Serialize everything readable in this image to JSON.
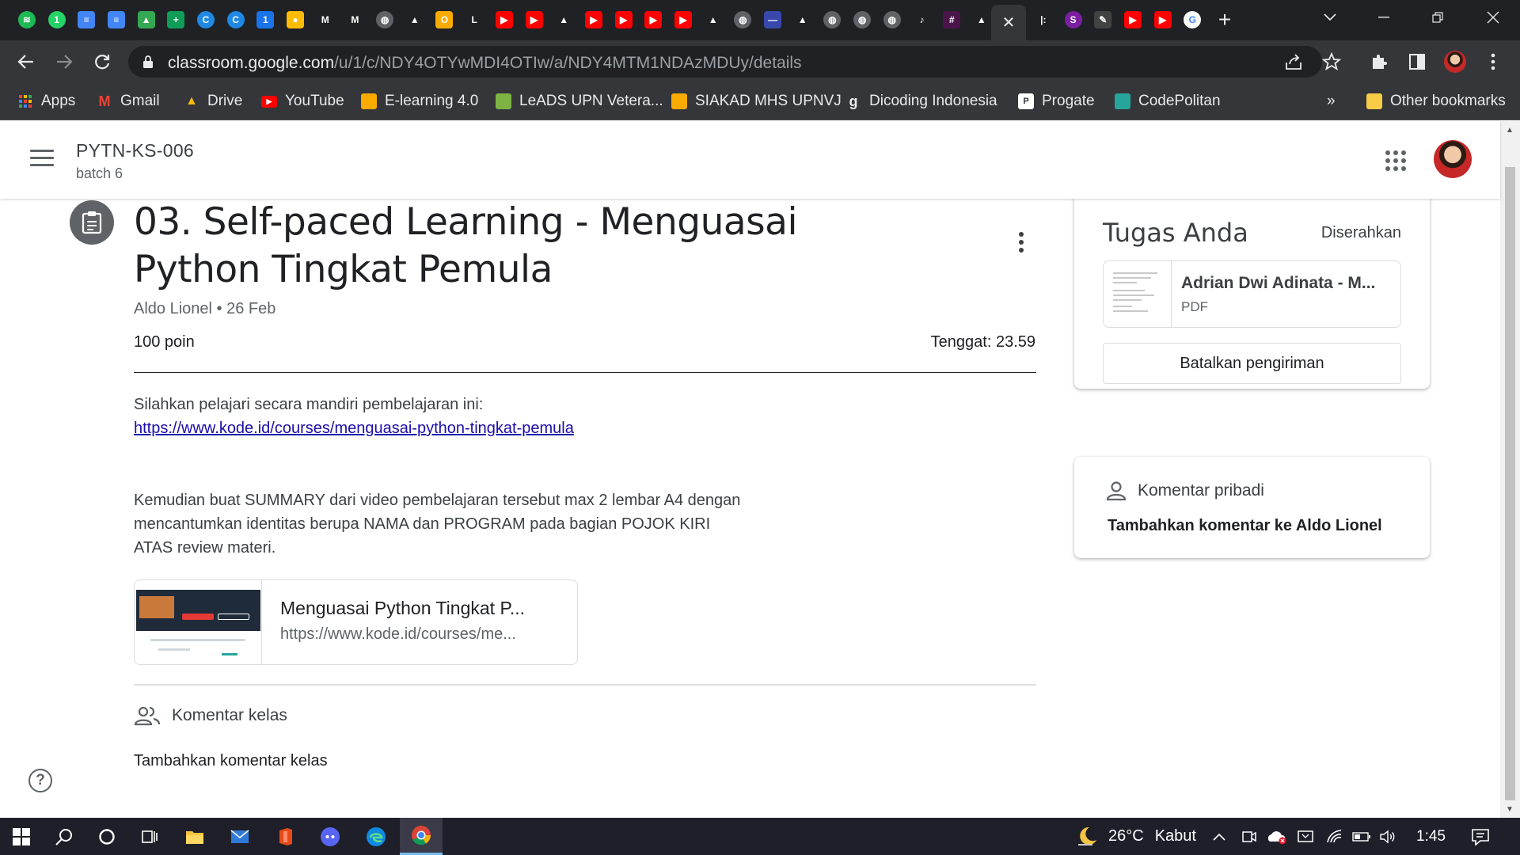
{
  "tabs": {
    "favicons": [
      {
        "name": "spotify-icon",
        "bg": "#1db954",
        "glyph": "≋",
        "round": true
      },
      {
        "name": "whatsapp-icon",
        "bg": "#25d366",
        "glyph": "1",
        "round": true
      },
      {
        "name": "google-docs-icon",
        "bg": "#4285f4",
        "glyph": "≡",
        "round": false
      },
      {
        "name": "google-docs-icon",
        "bg": "#4285f4",
        "glyph": "≡",
        "round": false
      },
      {
        "name": "google-drive-icon",
        "bg": "#34a853",
        "glyph": "▲",
        "round": false
      },
      {
        "name": "google-sheets-icon",
        "bg": "#0f9d58",
        "glyph": "+",
        "round": false
      },
      {
        "name": "codepolitan-icon",
        "bg": "#1e88e5",
        "glyph": "C",
        "round": true
      },
      {
        "name": "codepolitan-icon",
        "bg": "#1e88e5",
        "glyph": "C",
        "round": true
      },
      {
        "name": "calendar-icon",
        "bg": "#1a73e8",
        "glyph": "1",
        "round": false
      },
      {
        "name": "keep-icon",
        "bg": "#fbbc04",
        "glyph": "●",
        "round": false
      },
      {
        "name": "gmail-icon",
        "bg": "#202124",
        "glyph": "M",
        "round": false
      },
      {
        "name": "gmail-icon",
        "bg": "#202124",
        "glyph": "M",
        "round": false
      },
      {
        "name": "globe-icon",
        "bg": "#5f6368",
        "glyph": "◍",
        "round": true
      },
      {
        "name": "google-drive-icon",
        "bg": "#202124",
        "glyph": "▲",
        "round": false
      },
      {
        "name": "upnvj-icon",
        "bg": "#f9ab00",
        "glyph": "O",
        "round": false
      },
      {
        "name": "leads-upnvj-icon",
        "bg": "#202124",
        "glyph": "L",
        "round": false
      },
      {
        "name": "youtube-icon",
        "bg": "#ff0000",
        "glyph": "▶",
        "round": false
      },
      {
        "name": "youtube-icon",
        "bg": "#ff0000",
        "glyph": "▶",
        "round": false
      },
      {
        "name": "google-drive-icon",
        "bg": "#202124",
        "glyph": "▲",
        "round": false
      },
      {
        "name": "youtube-icon",
        "bg": "#ff0000",
        "glyph": "▶",
        "round": false
      },
      {
        "name": "youtube-icon",
        "bg": "#ff0000",
        "glyph": "▶",
        "round": false
      },
      {
        "name": "youtube-icon",
        "bg": "#ff0000",
        "glyph": "▶",
        "round": false
      },
      {
        "name": "youtube-icon",
        "bg": "#ff0000",
        "glyph": "▶",
        "round": false
      },
      {
        "name": "google-drive-icon",
        "bg": "#202124",
        "glyph": "▲",
        "round": false
      },
      {
        "name": "globe-icon",
        "bg": "#5f6368",
        "glyph": "◍",
        "round": true
      },
      {
        "name": "site-icon",
        "bg": "#3949ab",
        "glyph": "—",
        "round": false
      },
      {
        "name": "google-drive-icon",
        "bg": "#202124",
        "glyph": "▲",
        "round": false
      },
      {
        "name": "globe-icon",
        "bg": "#5f6368",
        "glyph": "◍",
        "round": true
      },
      {
        "name": "globe-icon",
        "bg": "#5f6368",
        "glyph": "◍",
        "round": true
      },
      {
        "name": "globe-icon",
        "bg": "#5f6368",
        "glyph": "◍",
        "round": true
      },
      {
        "name": "tiktok-icon",
        "bg": "#202124",
        "glyph": "♪",
        "round": false
      },
      {
        "name": "slack-icon",
        "bg": "#4a154b",
        "glyph": "#",
        "round": false
      },
      {
        "name": "google-drive-icon",
        "bg": "#202124",
        "glyph": "▲",
        "round": false
      }
    ],
    "active_close": "✕",
    "after_active": [
      {
        "name": "progate-icon",
        "bg": "#202124",
        "glyph": "|:",
        "round": false
      },
      {
        "name": "site-swirl-icon",
        "bg": "#7b1fa2",
        "glyph": "S",
        "round": true
      },
      {
        "name": "pen-icon",
        "bg": "#424242",
        "glyph": "✎",
        "round": false
      },
      {
        "name": "youtube-icon",
        "bg": "#ff0000",
        "glyph": "▶",
        "round": false
      },
      {
        "name": "youtube-icon",
        "bg": "#ff0000",
        "glyph": "▶",
        "round": false
      },
      {
        "name": "google-icon",
        "bg": "#ffffff",
        "glyph": "G",
        "round": true
      }
    ],
    "new_tab": "+"
  },
  "toolbar": {
    "url_host": "classroom.google.com",
    "url_path": "/u/1/c/NDY4OTYwMDI4OTIw/a/NDY4MTM1NDAzMDUy/details"
  },
  "bookmarks": [
    {
      "label": "Apps",
      "icon": "apps-grid-icon",
      "color": "#ea4335"
    },
    {
      "label": "Gmail",
      "icon": "gmail-icon",
      "color": "#ea4335"
    },
    {
      "label": "Drive",
      "icon": "google-drive-icon",
      "color": "#fbbc04"
    },
    {
      "label": "YouTube",
      "icon": "youtube-icon",
      "color": "#ff0000"
    },
    {
      "label": "E-learning 4.0",
      "icon": "elearning-icon",
      "color": "#f9ab00"
    },
    {
      "label": "LeADS UPN Vetera...",
      "icon": "leads-icon",
      "color": "#7cb342"
    },
    {
      "label": "SIAKAD MHS UPNVJ",
      "icon": "siakad-icon",
      "color": "#f9ab00"
    },
    {
      "label": "Dicoding Indonesia",
      "icon": "dicoding-icon",
      "color": "#35363a"
    },
    {
      "label": "Progate",
      "icon": "progate-icon",
      "color": "#ffffff"
    },
    {
      "label": "CodePolitan",
      "icon": "codepolitan-icon",
      "color": "#26a69a"
    }
  ],
  "bookmarks_overflow": "»",
  "other_bookmarks": "Other bookmarks",
  "classroom": {
    "class_name": "PYTN-KS-006",
    "section": "batch 6"
  },
  "assignment": {
    "title": "03. Self-paced Learning - Menguasai Python Tingkat Pemula",
    "author_date": "Aldo Lionel • 26 Feb",
    "points": "100 poin",
    "due": "Tenggat: 23.59",
    "desc_intro": "Silahkan pelajari secara mandiri pembelajaran ini:",
    "desc_link": "https://www.kode.id/courses/menguasai-python-tingkat-pemula",
    "desc_body_1": "Kemudian buat SUMMARY dari video pembelajaran tersebut max 2 lembar A4 dengan",
    "desc_body_2": "mencantumkan identitas berupa NAMA dan PROGRAM pada bagian POJOK KIRI",
    "desc_body_3": "ATAS review materi.",
    "material_title": "Menguasai Python Tingkat P...",
    "material_url": "https://www.kode.id/courses/me...",
    "class_comments_label": "Komentar kelas",
    "add_class_comment": "Tambahkan komentar kelas"
  },
  "your_work": {
    "heading": "Tugas Anda",
    "status": "Diserahkan",
    "file_name": "Adrian Dwi Adinata - M...",
    "file_type": "PDF",
    "unsubmit_label": "Batalkan pengiriman"
  },
  "private_comments": {
    "heading": "Komentar pribadi",
    "add": "Tambahkan komentar ke Aldo Lionel"
  },
  "taskbar": {
    "weather_temp": "26°C",
    "weather_desc": "Kabut",
    "time": "1:45"
  }
}
